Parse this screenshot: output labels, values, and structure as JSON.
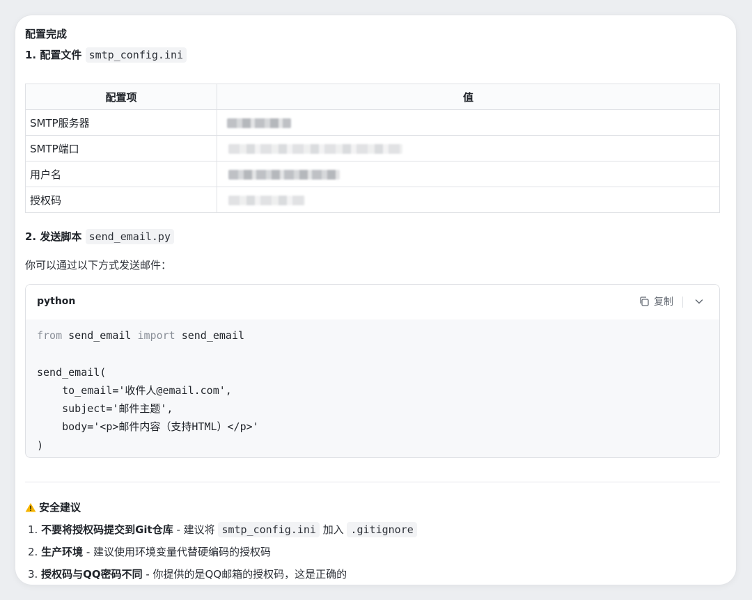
{
  "header": {
    "title": "配置完成"
  },
  "section1": {
    "prefix": "1. 配置文件",
    "filename": "smtp_config.ini"
  },
  "table": {
    "headers": [
      "配置项",
      "值"
    ],
    "rows": [
      {
        "key": "SMTP服务器"
      },
      {
        "key": "SMTP端口"
      },
      {
        "key": "用户名"
      },
      {
        "key": "授权码"
      }
    ]
  },
  "section2": {
    "prefix": "2. 发送脚本",
    "filename": "send_email.py",
    "intro": "你可以通过以下方式发送邮件："
  },
  "code": {
    "language": "python",
    "copy_label": "复制",
    "lines": [
      {
        "kw1": "from",
        "t1": " send_email ",
        "kw2": "import",
        "t2": " send_email"
      },
      {
        "text": ""
      },
      {
        "text": "send_email("
      },
      {
        "text": "    to_email='收件人@email.com',"
      },
      {
        "text": "    subject='邮件主题',"
      },
      {
        "text": "    body='<p>邮件内容（支持HTML）</p>'"
      },
      {
        "text": ")"
      }
    ]
  },
  "security": {
    "title": "安全建议",
    "items": [
      {
        "num": "1.",
        "bold": "不要将授权码提交到Git仓库",
        "text": " - 建议将 ",
        "code1": "smtp_config.ini",
        "text2": " 加入 ",
        "code2": ".gitignore"
      },
      {
        "num": "2.",
        "bold": "生产环境",
        "text": " - 建议使用环境变量代替硬编码的授权码"
      },
      {
        "num": "3.",
        "bold": "授权码与QQ密码不同",
        "text": " - 你提供的是QQ邮箱的授权码，这是正确的"
      }
    ]
  },
  "colors": {
    "warning": "#f5b400",
    "keyword": "#8a8f98"
  }
}
